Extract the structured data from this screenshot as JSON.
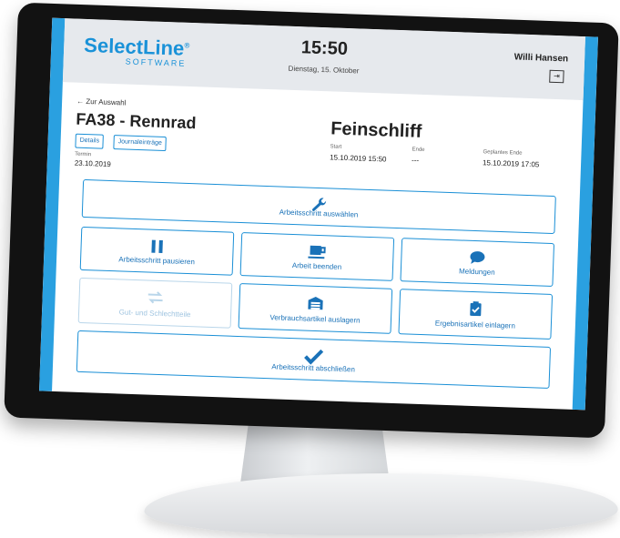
{
  "header": {
    "logo": "SelectLine",
    "logo_mark": "®",
    "logo_sub": "SOFTWARE",
    "time": "15:50",
    "date": "Dienstag, 15. Oktober",
    "user": "Willi Hansen"
  },
  "order": {
    "back_label": "Zur Auswahl",
    "title": "FA38 - Rennrad",
    "details_label": "Details",
    "journal_label": "Journaleinträge",
    "termin_label": "Termin",
    "termin_value": "23.10.2019"
  },
  "step": {
    "title": "Feinschliff",
    "start_label": "Start",
    "start_value": "15.10.2019 15:50",
    "end_label": "Ende",
    "end_value": "---",
    "planned_label": "Geplantes Ende",
    "planned_value": "15.10.2019 17:05"
  },
  "actions": {
    "select_step": "Arbeitsschritt auswählen",
    "pause": "Arbeitsschritt pausieren",
    "finish_work": "Arbeit beenden",
    "messages": "Meldungen",
    "good_bad": "Gut- und Schlechtteile",
    "consumables": "Verbrauchsartikel auslagern",
    "results": "Ergebnisartikel einlagern",
    "complete": "Arbeitsschritt abschließen"
  },
  "colors": {
    "accent": "#1a8fd6",
    "sidebar": "#2aa0e0",
    "topbar": "#e6e9ed",
    "disabled": "#b9d6ea"
  }
}
